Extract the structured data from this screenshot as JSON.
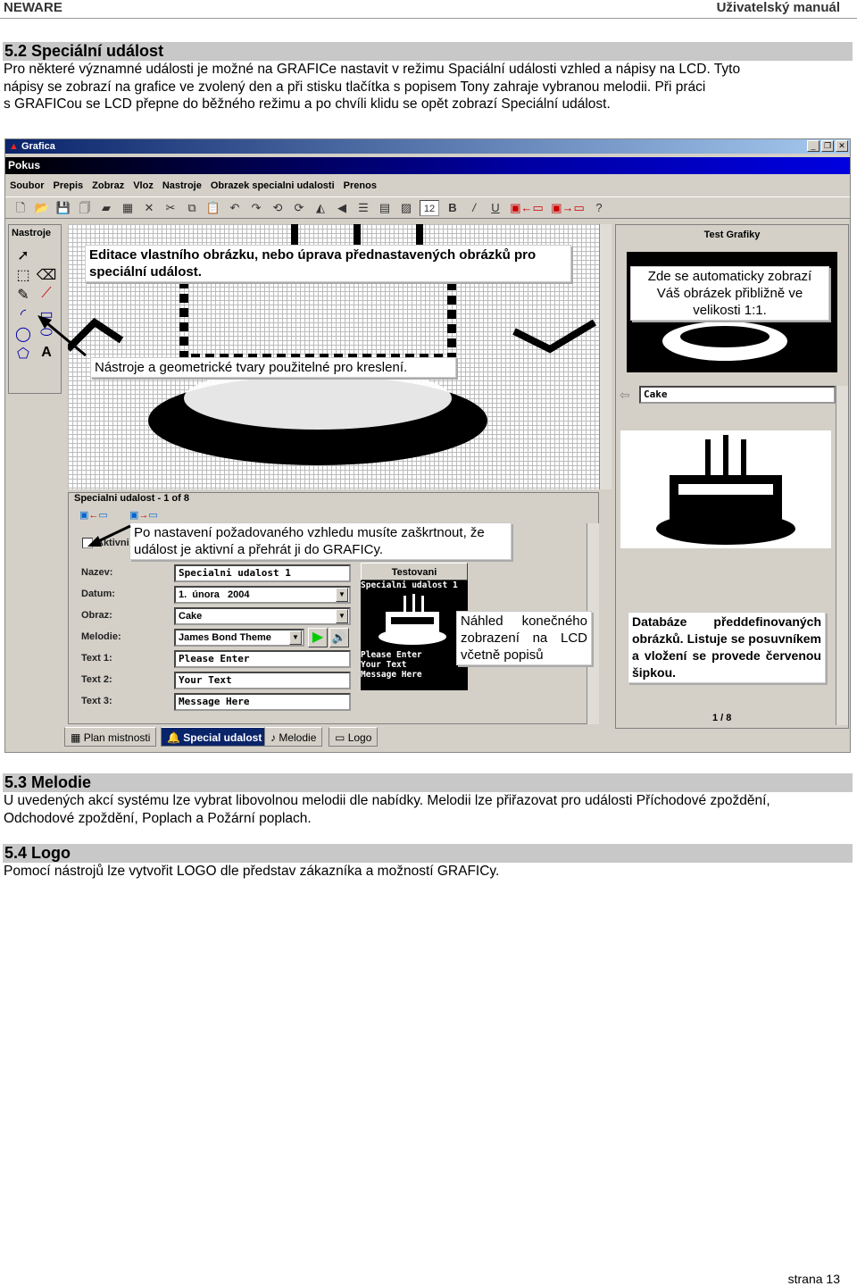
{
  "header": {
    "left": "NEWARE",
    "right": "Uživatelský manuál"
  },
  "section52": {
    "title": "5.2 Speciální událost",
    "lines": [
      "Pro některé významné události je možné na GRAFICe nastavit  v režimu Spaciální události vzhled a nápisy na LCD. Tyto",
      "nápisy se zobrazí na grafice ve zvolený den a při stisku tlačítka s popisem Tony zahraje vybranou melodii. Při práci",
      "s GRAFICou se LCD přepne do běžného režimu a po chvíli klidu se opět zobrazí Speciální událost."
    ]
  },
  "app": {
    "title": "Grafica",
    "doc_title": "Pokus",
    "menu": [
      "Soubor",
      "Prepis",
      "Zobraz",
      "Vloz",
      "Nastroje",
      "Obrazek specialni udalosti",
      "Prenos"
    ],
    "tools_label": "Nastroje",
    "font_size": "12",
    "right_panel_title": "Test Grafiky",
    "image_name": "Cake",
    "pager": "1 / 8",
    "group_title": "Specialni udalost - 1 of 8",
    "active_label": "Aktivni",
    "form": {
      "labels": [
        "Nazev:",
        "Datum:",
        "Obraz:",
        "Melodie:",
        "Text 1:",
        "Text 2:",
        "Text 3:"
      ],
      "nazev": "Specialni udalost 1",
      "datum": "1.  února   2004",
      "obraz": "Cake",
      "melodie": "James Bond Theme",
      "text1": "Please Enter",
      "text2": "Your Text",
      "text3": "Message Here"
    },
    "test_button": "Testovani",
    "lcd": {
      "title": "Specialni udalost 1",
      "line1": "Please Enter",
      "line2": "Your Text",
      "line3": "Message Here"
    },
    "tabs": [
      "Plan mistnosti",
      "Special udalost",
      "Melodie",
      "Logo"
    ],
    "active_tab": "Special udalost"
  },
  "callouts": {
    "editor": "Editace vlastního obrázku, nebo úprava přednastavených obrázků pro speciální událost.",
    "preview": "Zde se automaticky zobrazí Váš obrázek přibližně ve velikosti 1:1.",
    "tools": "Nástroje a geometrické tvary použitelné pro kreslení.",
    "active": "Po nastavení požadovaného vzhledu musíte zaškrtnout, že událost je aktivní a přehrát ji do GRAFICy.",
    "lcd": "Náhled konečného zobrazení na LCD včetně popisů",
    "database": "Databáze předdefinovaných obrázků. Listuje se posuvníkem a vložení se provede červenou šipkou."
  },
  "section53": {
    "title": "5.3 Melodie",
    "lines": [
      "U uvedených akcí systému lze vybrat libovolnou melodii dle nabídky. Melodii lze přiřazovat pro události Příchodové zpoždění,",
      "Odchodové zpoždění, Poplach a Požární poplach."
    ]
  },
  "section54": {
    "title": "5.4 Logo",
    "lines": [
      "Pomocí nástrojů lze vytvořit LOGO dle představ zákazníka a možností GRAFICy."
    ]
  },
  "footer": {
    "page": "strana 13"
  }
}
